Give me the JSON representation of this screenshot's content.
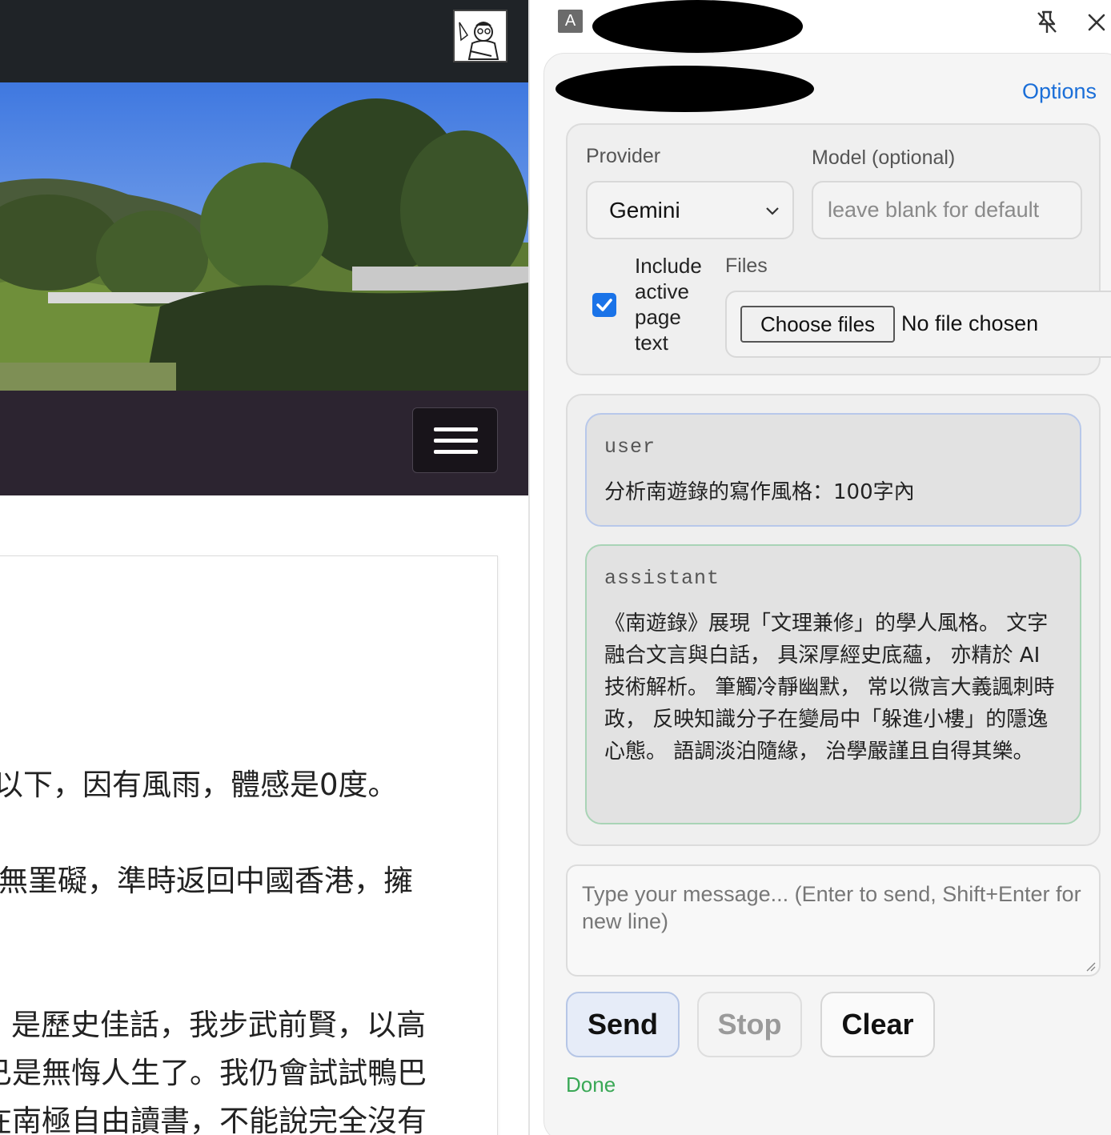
{
  "left_page": {
    "article_lines": [
      "以下，因有風雨，體感是0度。",
      "無罣礙，準時返回中國香港，擁",
      "是歷史佳話，我步武前賢，以高",
      "已是無悔人生了。我仍會試試鴨巴",
      "在南極自由讀書，不能說完全沒有"
    ]
  },
  "panel": {
    "extension_badge": "A",
    "options_label": "Options",
    "settings": {
      "provider_label": "Provider",
      "provider_value": "Gemini",
      "model_label": "Model (optional)",
      "model_placeholder": "leave blank for default",
      "include_label": "Include active page text",
      "include_checked": true,
      "files_label": "Files",
      "choose_files_label": "Choose files",
      "no_file_label": "No file chosen"
    },
    "messages": [
      {
        "role": "user",
        "text": "分析南遊錄的寫作風格：100字內"
      },
      {
        "role": "assistant",
        "text": "《南遊錄》展現「文理兼修」的學人風格。 文字融合文言與白話， 具深厚經史底蘊， 亦精於 AI 技術解析。 筆觸冷靜幽默， 常以微言大義諷刺時政， 反映知識分子在變局中「躲進小樓」的隱逸心態。 語調淡泊隨緣， 治學嚴謹且自得其樂。"
      }
    ],
    "composer_placeholder": "Type your message... (Enter to send, Shift+Enter for new line)",
    "buttons": {
      "send": "Send",
      "stop": "Stop",
      "clear": "Clear"
    },
    "status": "Done",
    "colors": {
      "accent": "#1a73e8",
      "link": "#1a6ed8",
      "status": "#3aa856"
    }
  }
}
